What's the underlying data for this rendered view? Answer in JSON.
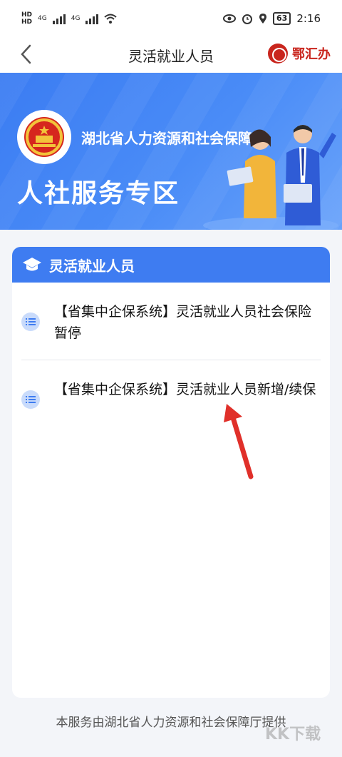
{
  "status_bar": {
    "network1": "4G",
    "network2": "4G",
    "battery": "63",
    "time": "2:16"
  },
  "nav": {
    "title": "灵活就业人员",
    "brand_name": "鄂汇办"
  },
  "banner": {
    "org_name": "湖北省人力资源和社会保障厅",
    "title": "人社服务专区"
  },
  "section": {
    "title": "灵活就业人员",
    "items": [
      {
        "label": "【省集中企保系统】灵活就业人员社会保险暂停"
      },
      {
        "label": "【省集中企保系统】灵活就业人员新增/续保"
      }
    ]
  },
  "footer": {
    "text": "本服务由湖北省人力资源和社会保障厅提供",
    "watermark": "KK下载 www.kkx.net"
  },
  "colors": {
    "primary": "#3e7cf1",
    "brand_red": "#c9251d",
    "annotation_arrow": "#e0302a"
  }
}
